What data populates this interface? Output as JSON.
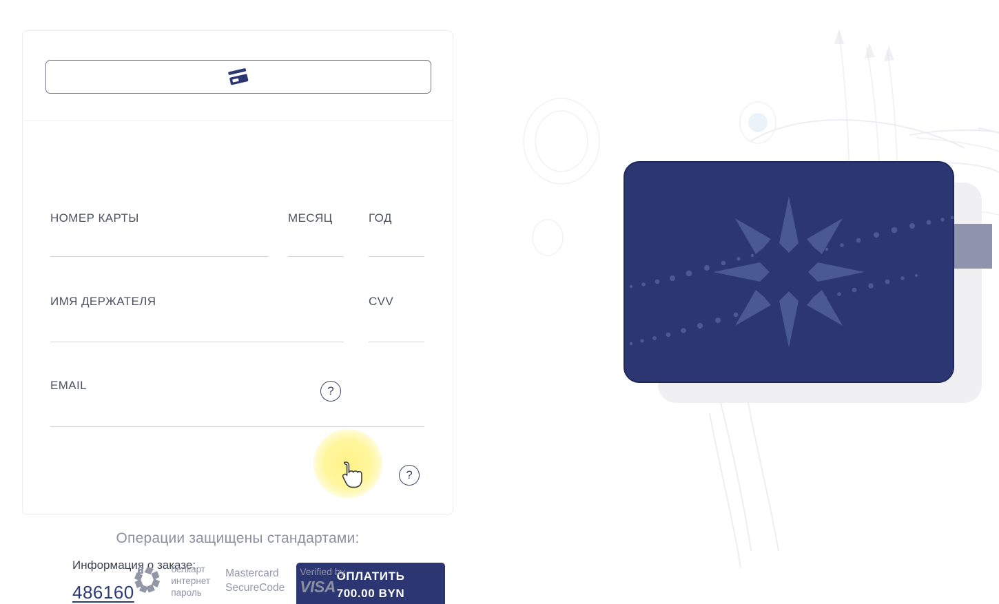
{
  "app": {
    "title": "Payment form",
    "accent_navy": "#2b3672",
    "card_navy": "#2b3672",
    "label_gray": "#4c5260",
    "line_gray": "#d2d2d6",
    "highlight_yellow": "#fff386"
  },
  "tabs": [
    {
      "label": "",
      "icon": "credit-card-icon",
      "selected": true
    }
  ],
  "form": {
    "fields": [
      {
        "key": "card_number",
        "label": "НОМЕР КАРТЫ",
        "value": "",
        "placeholder": ""
      },
      {
        "key": "month",
        "label": "МЕСЯЦ",
        "value": "",
        "placeholder": ""
      },
      {
        "key": "year",
        "label": "ГОД",
        "value": "",
        "placeholder": ""
      },
      {
        "key": "holder_name",
        "label": "ИМЯ ДЕРЖАТЕЛЯ",
        "value": "",
        "placeholder": ""
      },
      {
        "key": "cvv",
        "label": "CVV",
        "value": "",
        "placeholder": ""
      },
      {
        "key": "email",
        "label": "EMAIL",
        "value": "",
        "placeholder": ""
      }
    ],
    "help_icon": "?",
    "help_name": "question-mark-icon"
  },
  "order": {
    "label": "Информация о заказе:",
    "number": "486160"
  },
  "pay_button": {
    "line1": "ОПЛАТИТЬ",
    "line2": "700.00 BYN",
    "amount": "700.00",
    "currency": "BYN"
  },
  "footer": {
    "title": "Операции защищены стандартами:",
    "badges": [
      {
        "name": "belkart",
        "line1": "белкарт",
        "line2": "интернет",
        "line3": "пароль"
      },
      {
        "name": "mastercard-securecode",
        "line1": "Mastercard",
        "line2": "SecureCode"
      },
      {
        "name": "verified-by-visa",
        "line1": "Verified by",
        "line2": "VISA"
      }
    ]
  },
  "illustration": {
    "name": "bank-card-illustration",
    "front_card_color": "#2b3672",
    "back_card_color": "#f0f0f2",
    "stripe_color": "#8e94ab",
    "star_color": "#4a5894"
  }
}
